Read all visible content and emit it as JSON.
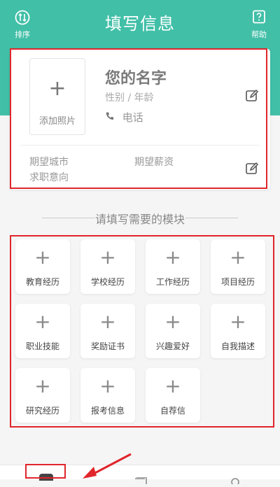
{
  "header": {
    "title": "填写信息",
    "left_button": {
      "label": "排序",
      "icon": "sort-icon"
    },
    "right_button": {
      "label": "帮助",
      "icon": "help-icon"
    }
  },
  "profile": {
    "photo_label": "添加照片",
    "name": "您的名字",
    "gender_age": "性别 / 年龄",
    "phone": "电话",
    "expected_city": "期望城市",
    "job_intent": "求职意向",
    "expected_salary": "期望薪资"
  },
  "section_title": "请填写需要的模块",
  "modules": [
    "教育经历",
    "学校经历",
    "工作经历",
    "项目经历",
    "职业技能",
    "奖励证书",
    "兴趣爱好",
    "自我描述",
    "研究经历",
    "报考信息",
    "自荐信"
  ],
  "colors": {
    "accent": "#41bfa7",
    "highlight": "#e0262b"
  }
}
